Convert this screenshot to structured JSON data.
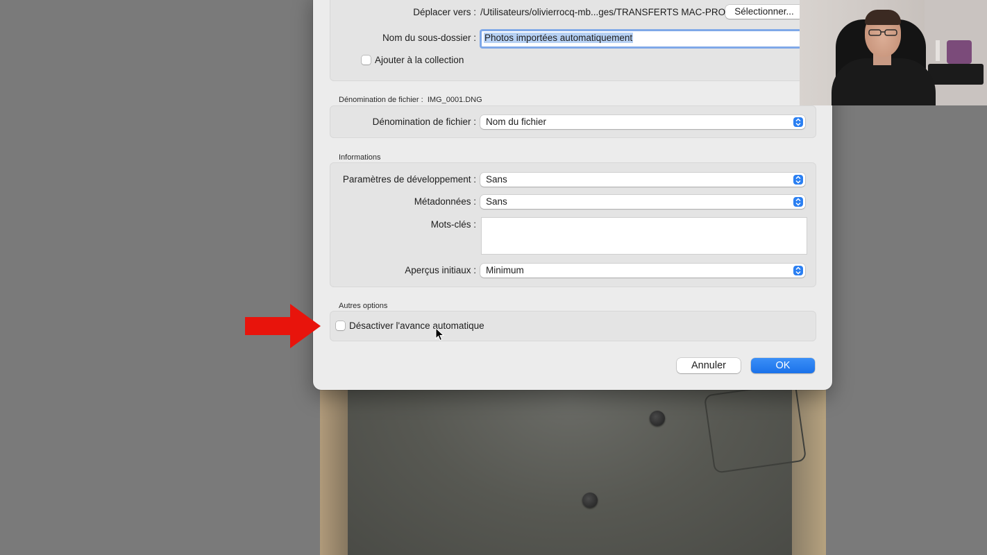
{
  "destination": {
    "move_to_label": "Déplacer vers :",
    "move_to_path": "/Utilisateurs/olivierrocq-mb...ges/TRANSFERTS MAC-PRO",
    "select_button": "Sélectionner...",
    "subfolder_label": "Nom du sous-dossier :",
    "subfolder_value": "Photos importées automatiquement",
    "add_collection_label": "Ajouter à la collection",
    "add_collection_checked": false
  },
  "file_naming": {
    "section_title": "Dénomination de fichier :",
    "sample": "IMG_0001.DNG",
    "label": "Dénomination de fichier :",
    "value": "Nom du fichier"
  },
  "informations": {
    "section_title": "Informations",
    "develop_label": "Paramètres de développement :",
    "develop_value": "Sans",
    "metadata_label": "Métadonnées :",
    "metadata_value": "Sans",
    "keywords_label": "Mots-clés :",
    "keywords_value": "",
    "previews_label": "Aperçus initiaux :",
    "previews_value": "Minimum"
  },
  "other_options": {
    "section_title": "Autres options",
    "auto_advance_label": "Désactiver l'avance automatique",
    "auto_advance_checked": false
  },
  "buttons": {
    "cancel": "Annuler",
    "ok": "OK"
  },
  "colors": {
    "accent": "#1b72ea",
    "annotation_arrow": "#e8140c"
  }
}
